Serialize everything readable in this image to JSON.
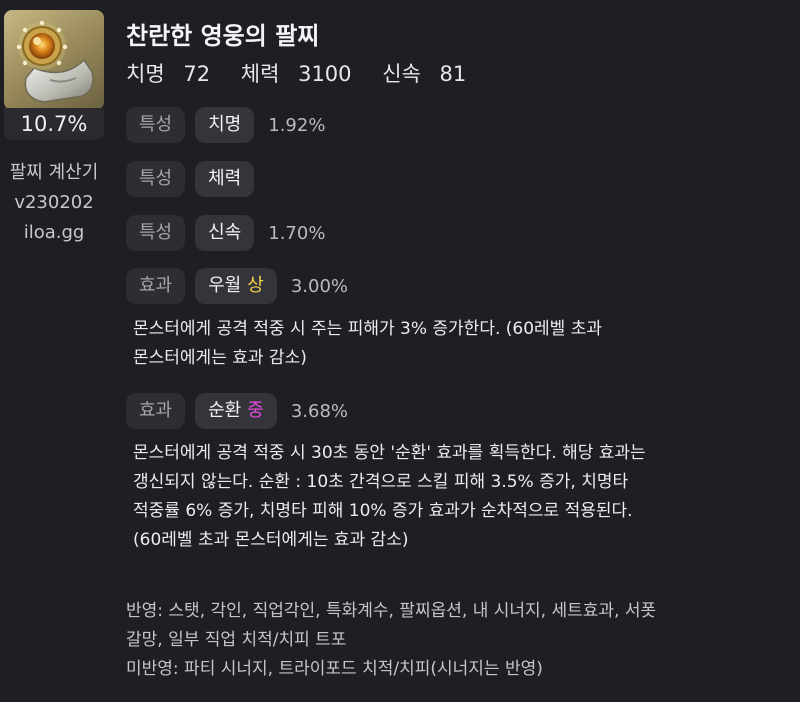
{
  "item": {
    "icon": "bracelet-icon",
    "percent": "10.7%",
    "title": "찬란한 영웅의 팔찌",
    "stats": [
      {
        "label": "치명",
        "value": "72"
      },
      {
        "label": "체력",
        "value": "3100"
      },
      {
        "label": "신속",
        "value": "81"
      }
    ]
  },
  "calculator": {
    "name": "팔찌 계산기",
    "version": "v230202",
    "site": "iloa.gg"
  },
  "rows": [
    {
      "category": "특성",
      "name": "치명",
      "grade": "",
      "value": "1.92%"
    },
    {
      "category": "특성",
      "name": "체력",
      "grade": "",
      "value": ""
    },
    {
      "category": "특성",
      "name": "신속",
      "grade": "",
      "value": "1.70%"
    },
    {
      "category": "효과",
      "name": "우월",
      "grade": "상",
      "value": "3.00%",
      "description": [
        "몬스터에게 공격 적중 시 주는 피해가 3% 증가한다. (60레벨 초과",
        "몬스터에게는 효과 감소)"
      ]
    },
    {
      "category": "효과",
      "name": "순환",
      "grade": "중",
      "value": "3.68%",
      "description": [
        "몬스터에게 공격 적중 시 30초 동안 '순환' 효과를 획득한다. 해당 효과는",
        "갱신되지 않는다. 순환 : 10초 간격으로 스킬 피해 3.5% 증가, 치명타",
        "적중률 6% 증가, 치명타 피해 10% 증가 효과가 순차적으로 적용된다.",
        "(60레벨 초과 몬스터에게는 효과 감소)"
      ]
    }
  ],
  "notes": [
    "반영: 스탯, 각인, 직업각인, 특화계수, 팔찌옵션, 내 시너지, 세트효과, 서폿",
    "갈망, 일부 직업 치적/치피 트포",
    "미반영: 파티 시너지, 트라이포드 치적/치피(시너지는 반영)"
  ],
  "colors": {
    "background": "#1f1f23",
    "grade_high": "#f2d14a",
    "grade_mid": "#e34ae0"
  }
}
